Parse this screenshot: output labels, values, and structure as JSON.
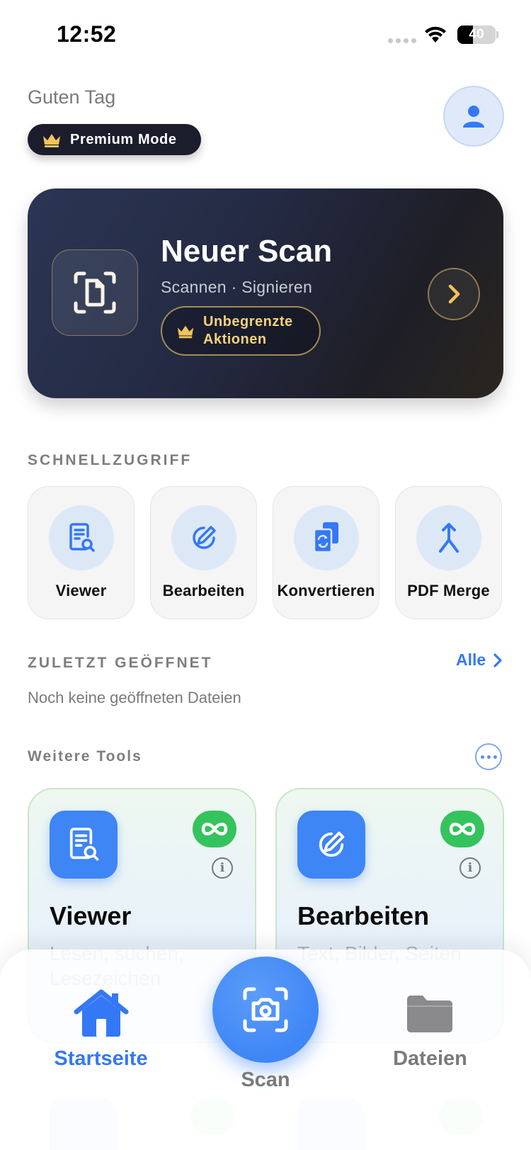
{
  "status_bar": {
    "time": "12:52",
    "battery": "40"
  },
  "header": {
    "greeting": "Guten Tag",
    "premium_label": "Premium Mode"
  },
  "scan_card": {
    "title": "Neuer Scan",
    "subtitle": "Scannen · Signieren",
    "badge": "Unbegrenzte Aktionen"
  },
  "quick_access": {
    "heading": "SCHNELLZUGRIFF",
    "items": [
      {
        "label": "Viewer",
        "icon": "viewer-icon"
      },
      {
        "label": "Bearbeiten",
        "icon": "edit-icon"
      },
      {
        "label": "Konvertieren",
        "icon": "convert-icon"
      },
      {
        "label": "PDF Merge",
        "icon": "merge-icon"
      }
    ]
  },
  "recent": {
    "heading": "ZULETZT GEÖFFNET",
    "all_link": "Alle",
    "empty": "Noch keine geöffneten Dateien"
  },
  "more_tools": {
    "heading": "Weitere Tools",
    "cards": [
      {
        "name": "Viewer",
        "desc": "Lesen, suchen, Lesezeichen",
        "icon": "viewer-icon",
        "badge": "infinity-icon"
      },
      {
        "name": "Bearbeiten",
        "desc": "Text, Bilder, Seiten",
        "icon": "edit-icon",
        "badge": "infinity-icon"
      }
    ]
  },
  "tab_bar": {
    "home": "Startseite",
    "scan": "Scan",
    "files": "Dateien"
  },
  "colors": {
    "accent": "#3478f6",
    "premium_gold": "#f3d27b",
    "unlimited_green": "#34c35d",
    "card_dark": "#232941"
  }
}
